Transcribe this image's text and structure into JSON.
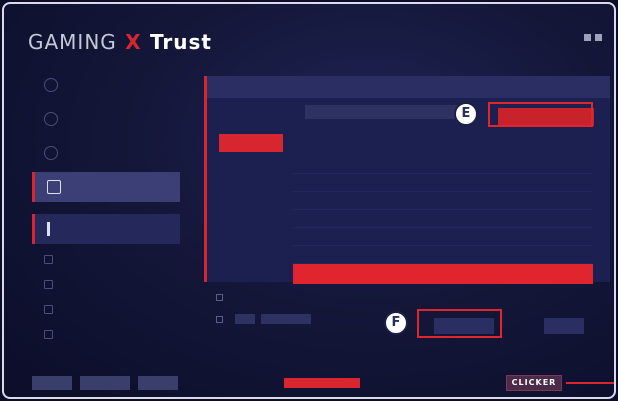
{
  "app": {
    "brand_left": "GAMING",
    "brand_x": "X",
    "brand_right": "Trust"
  },
  "callouts": {
    "e": "E",
    "f": "F"
  },
  "footer": {
    "logo": "CLICKER"
  }
}
